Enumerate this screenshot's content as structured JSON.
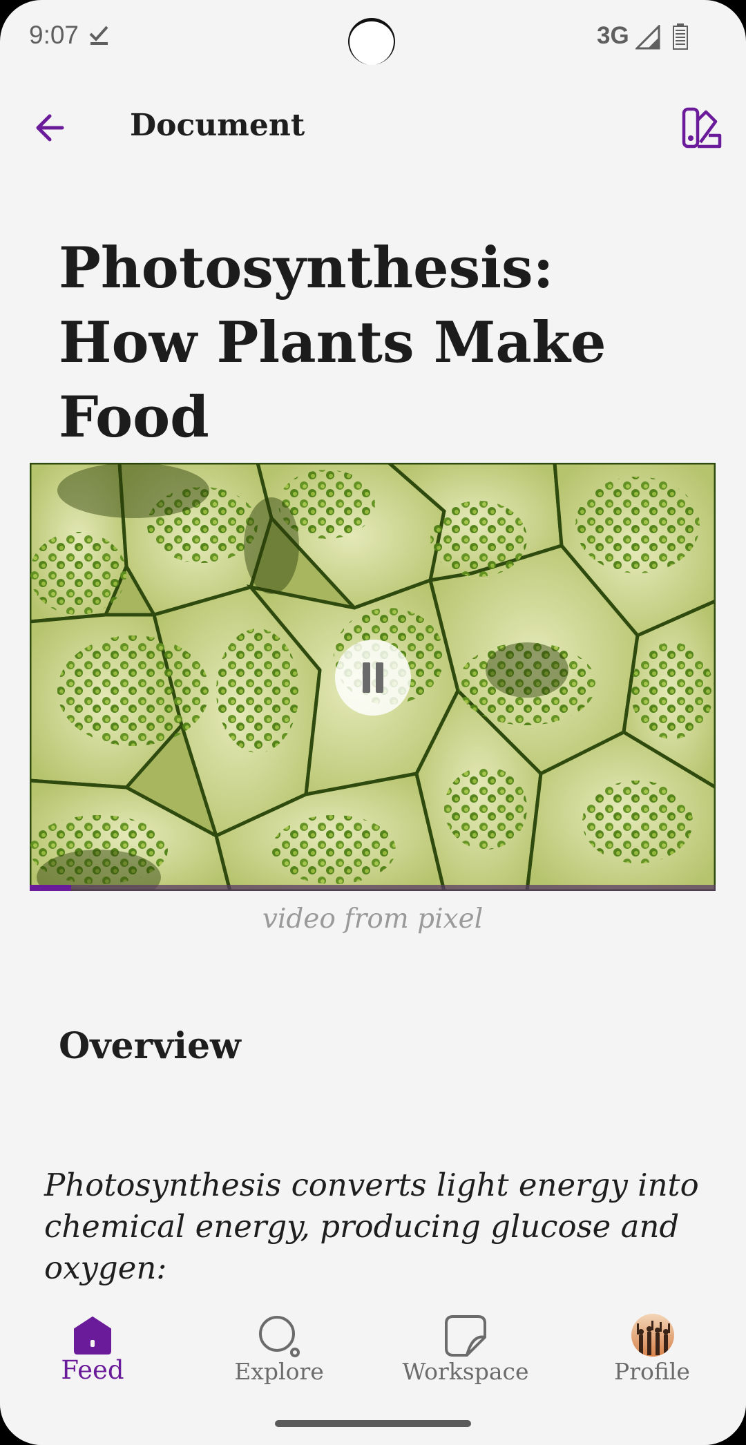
{
  "status_bar": {
    "time": "9:07",
    "network": "3G",
    "icons": [
      "check-icon",
      "signal-icon",
      "battery-icon"
    ]
  },
  "app_bar": {
    "title": "Document",
    "back_icon": "arrow-back-icon",
    "action_icon": "palette-swatch-icon"
  },
  "article": {
    "title": "Photosynthesis: How Plants Make Food",
    "video": {
      "caption": "video from pixel",
      "state": "playing",
      "control_icon": "pause-icon",
      "progress_fraction": 0.06
    },
    "section_heading": "Overview",
    "body": "Photosynthesis converts light energy into chemical energy, producing glucose and oxygen:"
  },
  "bottom_nav": {
    "items": [
      {
        "label": "Feed",
        "icon": "home-icon",
        "active": true
      },
      {
        "label": "Explore",
        "icon": "search-icon",
        "active": false
      },
      {
        "label": "Workspace",
        "icon": "note-icon",
        "active": false
      },
      {
        "label": "Profile",
        "icon": "avatar",
        "active": false
      }
    ]
  },
  "colors": {
    "accent": "#6a1b9a",
    "background": "#f4f4f4",
    "text": "#1e1e1e",
    "muted": "#9a9a9a"
  }
}
